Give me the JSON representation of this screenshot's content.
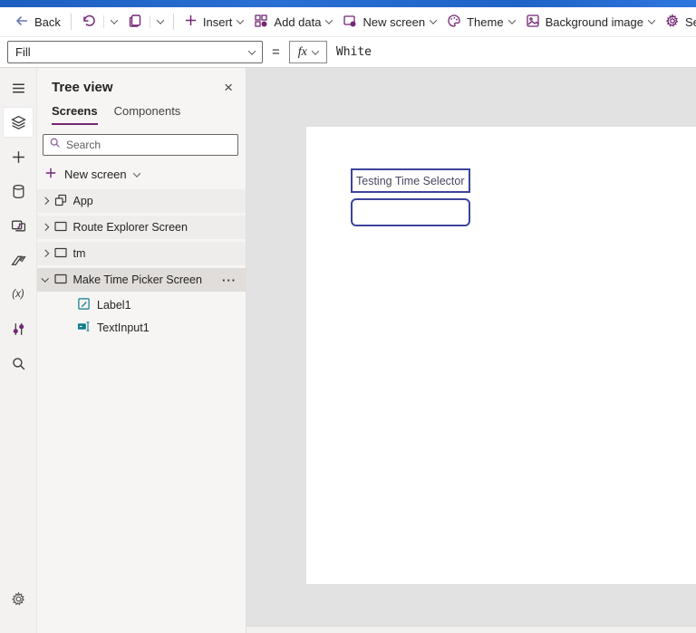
{
  "command_bar": {
    "back_label": "Back",
    "insert_label": "Insert",
    "add_data_label": "Add data",
    "new_screen_label": "New screen",
    "theme_label": "Theme",
    "background_image_label": "Background image",
    "settings_label": "Sett"
  },
  "formula_bar": {
    "property": "Fill",
    "equals": "=",
    "fx_label": "fx",
    "formula": "White"
  },
  "rail": {
    "icons": [
      "menu-icon",
      "tree-view-icon",
      "plus-icon",
      "data-icon",
      "media-icon",
      "power-automate-icon",
      "variables-icon",
      "controls-icon",
      "search-icon",
      "settings-icon"
    ],
    "variables_glyph": "(x)"
  },
  "tree": {
    "title": "Tree view",
    "close_glyph": "×",
    "tabs": [
      {
        "label": "Screens",
        "active": true
      },
      {
        "label": "Components",
        "active": false
      }
    ],
    "search_placeholder": "Search",
    "new_screen_label": "New screen",
    "more_options_glyph": "···",
    "items": [
      {
        "label": "App",
        "icon": "app-icon",
        "expanded": false,
        "selected": false
      },
      {
        "label": "Route Explorer Screen",
        "icon": "screen-icon",
        "expanded": false,
        "selected": false
      },
      {
        "label": "tm",
        "icon": "screen-icon",
        "expanded": false,
        "selected": false
      },
      {
        "label": "Make Time Picker Screen",
        "icon": "screen-icon",
        "expanded": true,
        "selected": true,
        "children": [
          {
            "label": "Label1",
            "icon": "label-icon"
          },
          {
            "label": "TextInput1",
            "icon": "text-input-icon"
          }
        ]
      }
    ]
  },
  "canvas": {
    "label_text": "Testing Time Selector",
    "input_value": ""
  },
  "colors": {
    "accent_purple": "#742774",
    "control_border_blue": "#3c449b",
    "control_icon_teal": "#0f7d8a",
    "titlebar_blue": "#2a6fd4",
    "selected_row": "#e0ddda",
    "canvas_fill_value": "White"
  }
}
